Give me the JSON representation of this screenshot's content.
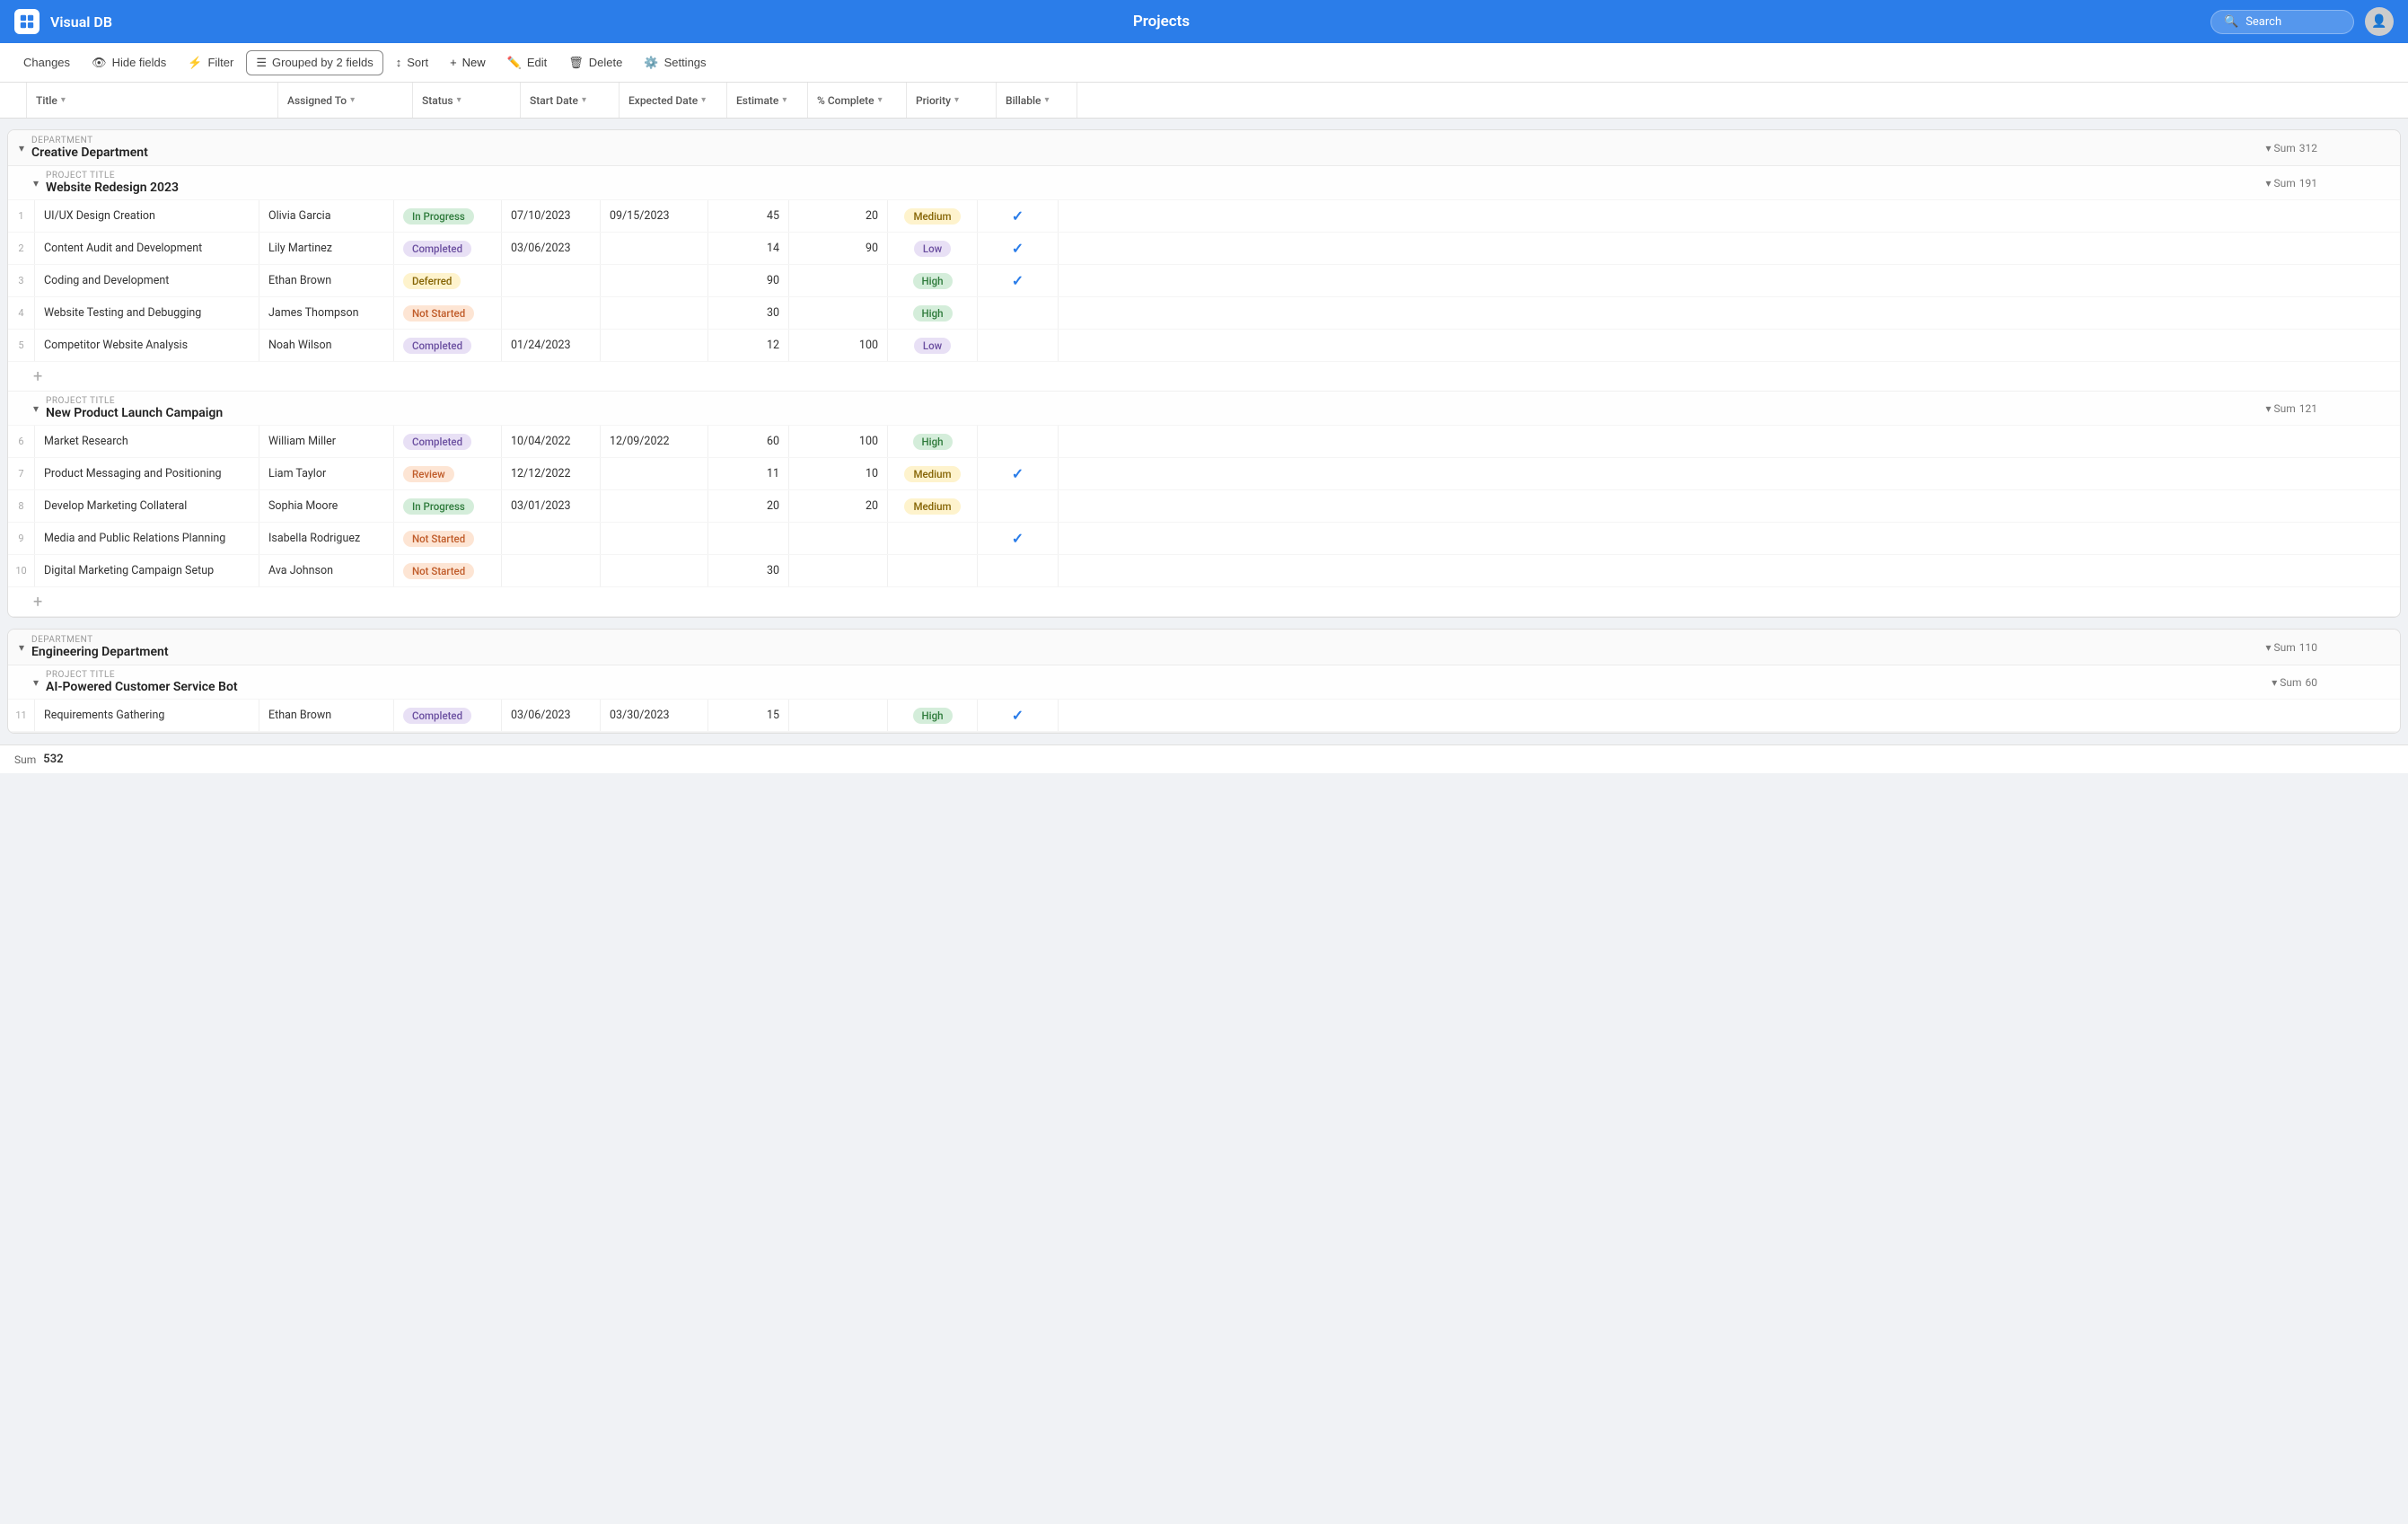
{
  "app": {
    "name": "Visual DB",
    "title": "Projects",
    "search_placeholder": "Search"
  },
  "toolbar": {
    "changes": "Changes",
    "hide_fields": "Hide fields",
    "filter": "Filter",
    "grouped_by": "Grouped by 2 fields",
    "sort": "Sort",
    "new": "New",
    "edit": "Edit",
    "delete": "Delete",
    "settings": "Settings"
  },
  "columns": [
    {
      "id": "title",
      "label": "Title"
    },
    {
      "id": "assigned",
      "label": "Assigned To"
    },
    {
      "id": "status",
      "label": "Status"
    },
    {
      "id": "start",
      "label": "Start Date"
    },
    {
      "id": "expected",
      "label": "Expected Date"
    },
    {
      "id": "estimate",
      "label": "Estimate"
    },
    {
      "id": "complete",
      "label": "% Complete"
    },
    {
      "id": "priority",
      "label": "Priority"
    },
    {
      "id": "billable",
      "label": "Billable"
    }
  ],
  "groups": [
    {
      "id": "creative",
      "dept_label": "DEPARTMENT",
      "dept_name": "Creative Department",
      "sum": 312,
      "subgroups": [
        {
          "id": "website-redesign",
          "proj_label": "PROJECT TITLE",
          "proj_name": "Website Redesign 2023",
          "sum": 191,
          "rows": [
            {
              "num": 1,
              "title": "UI/UX Design Creation",
              "assigned": "Olivia Garcia",
              "status": "In Progress",
              "status_class": "badge-inprogress",
              "start": "07/10/2023",
              "expected": "09/15/2023",
              "estimate": 45,
              "complete": 20,
              "priority": "Medium",
              "priority_class": "pri-medium",
              "billable": true
            },
            {
              "num": 2,
              "title": "Content Audit and Development",
              "assigned": "Lily Martinez",
              "status": "Completed",
              "status_class": "badge-completed",
              "start": "03/06/2023",
              "expected": "",
              "estimate": 14,
              "complete": 90,
              "priority": "Low",
              "priority_class": "pri-low",
              "billable": true
            },
            {
              "num": 3,
              "title": "Coding and Development",
              "assigned": "Ethan Brown",
              "status": "Deferred",
              "status_class": "badge-deferred",
              "start": "",
              "expected": "",
              "estimate": 90,
              "complete": "",
              "priority": "High",
              "priority_class": "pri-high",
              "billable": true
            },
            {
              "num": 4,
              "title": "Website Testing and Debugging",
              "assigned": "James Thompson",
              "status": "Not Started",
              "status_class": "badge-notstarted",
              "start": "",
              "expected": "",
              "estimate": 30,
              "complete": "",
              "priority": "High",
              "priority_class": "pri-high",
              "billable": false
            },
            {
              "num": 5,
              "title": "Competitor Website Analysis",
              "assigned": "Noah Wilson",
              "status": "Completed",
              "status_class": "badge-completed",
              "start": "01/24/2023",
              "expected": "",
              "estimate": 12,
              "complete": 100,
              "priority": "Low",
              "priority_class": "pri-low",
              "billable": false
            }
          ]
        },
        {
          "id": "new-product-launch",
          "proj_label": "PROJECT TITLE",
          "proj_name": "New Product Launch Campaign",
          "sum": 121,
          "rows": [
            {
              "num": 6,
              "title": "Market Research",
              "assigned": "William Miller",
              "status": "Completed",
              "status_class": "badge-completed",
              "start": "10/04/2022",
              "expected": "12/09/2022",
              "estimate": 60,
              "complete": 100,
              "priority": "High",
              "priority_class": "pri-high",
              "billable": false
            },
            {
              "num": 7,
              "title": "Product Messaging and Positioning",
              "assigned": "Liam Taylor",
              "status": "Review",
              "status_class": "badge-review",
              "start": "12/12/2022",
              "expected": "",
              "estimate": 11,
              "complete": 10,
              "priority": "Medium",
              "priority_class": "pri-medium",
              "billable": true
            },
            {
              "num": 8,
              "title": "Develop Marketing Collateral",
              "assigned": "Sophia Moore",
              "status": "In Progress",
              "status_class": "badge-inprogress",
              "start": "03/01/2023",
              "expected": "",
              "estimate": 20,
              "complete": 20,
              "priority": "Medium",
              "priority_class": "pri-medium",
              "billable": false
            },
            {
              "num": 9,
              "title": "Media and Public Relations Planning",
              "assigned": "Isabella Rodriguez",
              "status": "Not Started",
              "status_class": "badge-notstarted",
              "start": "",
              "expected": "",
              "estimate": "",
              "complete": "",
              "priority": "",
              "priority_class": "",
              "billable": true
            },
            {
              "num": 10,
              "title": "Digital Marketing Campaign Setup",
              "assigned": "Ava Johnson",
              "status": "Not Started",
              "status_class": "badge-notstarted",
              "start": "",
              "expected": "",
              "estimate": 30,
              "complete": "",
              "priority": "",
              "priority_class": "",
              "billable": false
            }
          ]
        }
      ]
    },
    {
      "id": "engineering",
      "dept_label": "DEPARTMENT",
      "dept_name": "Engineering Department",
      "sum": 110,
      "subgroups": [
        {
          "id": "ai-customer-bot",
          "proj_label": "PROJECT TITLE",
          "proj_name": "AI-Powered Customer Service Bot",
          "sum": 60,
          "rows": [
            {
              "num": 11,
              "title": "Requirements Gathering",
              "assigned": "Ethan Brown",
              "status": "Completed",
              "status_class": "badge-completed",
              "start": "03/06/2023",
              "expected": "03/30/2023",
              "estimate": 15,
              "complete": "",
              "priority": "High",
              "priority_class": "pri-high",
              "billable": true
            }
          ]
        }
      ]
    }
  ],
  "footer": {
    "sum_label": "Sum",
    "sum_value": 532
  },
  "status": {
    "not_started_label": "Not Started",
    "completed_label": "Completed"
  }
}
